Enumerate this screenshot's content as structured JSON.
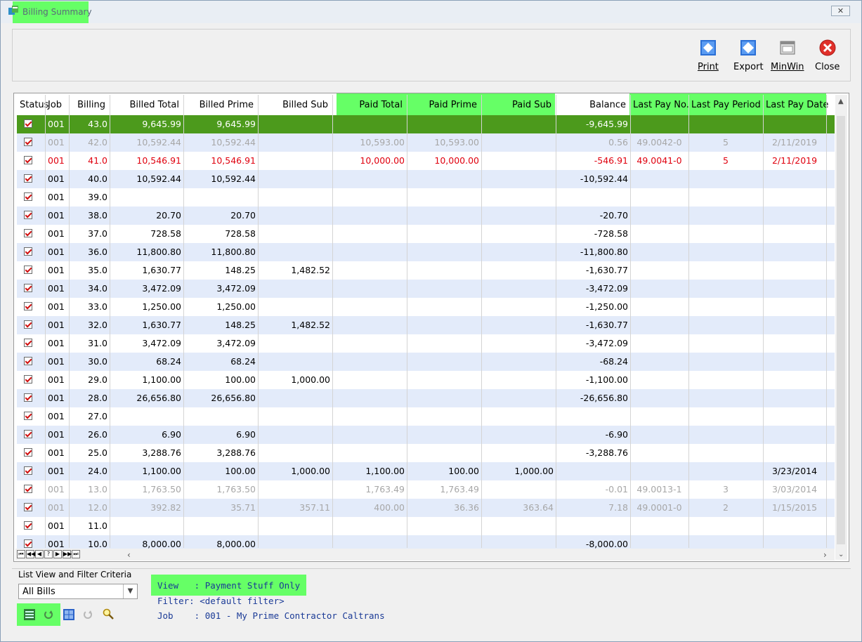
{
  "window": {
    "title": "Billing Summary",
    "close_glyph": "✕"
  },
  "toolbar": {
    "print_label": "Print",
    "export_label": "Export",
    "minwin_label": "MinWin",
    "close_label": "Close"
  },
  "grid": {
    "columns": [
      "Status",
      "Job",
      "Billing",
      "Billed Total",
      "Billed Prime",
      "Billed Sub",
      "Paid Total",
      "Paid Prime",
      "Paid Sub",
      "Balance",
      "Last Pay No.",
      "Last Pay Period",
      "Last Pay Date"
    ],
    "highlighted_columns": [
      "Paid Total",
      "Paid Prime",
      "Paid Sub",
      "Last Pay No.",
      "Last Pay Period",
      "Last Pay Date"
    ],
    "rows": [
      {
        "style": "selected",
        "job": "001",
        "billing": "43.0",
        "billed_total": "9,645.99",
        "billed_prime": "9,645.99",
        "billed_sub": "",
        "paid_total": "",
        "paid_prime": "",
        "paid_sub": "",
        "balance": "-9,645.99",
        "last_pay_no": "",
        "last_pay_period": "",
        "last_pay_date": ""
      },
      {
        "style": "grey",
        "job": "001",
        "billing": "42.0",
        "billed_total": "10,592.44",
        "billed_prime": "10,592.44",
        "billed_sub": "",
        "paid_total": "10,593.00",
        "paid_prime": "10,593.00",
        "paid_sub": "",
        "balance": "0.56",
        "last_pay_no": "49.0042-0",
        "last_pay_period": "5",
        "last_pay_date": "2/11/2019"
      },
      {
        "style": "red",
        "job": "001",
        "billing": "41.0",
        "billed_total": "10,546.91",
        "billed_prime": "10,546.91",
        "billed_sub": "",
        "paid_total": "10,000.00",
        "paid_prime": "10,000.00",
        "paid_sub": "",
        "balance": "-546.91",
        "last_pay_no": "49.0041-0",
        "last_pay_period": "5",
        "last_pay_date": "2/11/2019"
      },
      {
        "style": "normal",
        "job": "001",
        "billing": "40.0",
        "billed_total": "10,592.44",
        "billed_prime": "10,592.44",
        "billed_sub": "",
        "paid_total": "",
        "paid_prime": "",
        "paid_sub": "",
        "balance": "-10,592.44",
        "last_pay_no": "",
        "last_pay_period": "",
        "last_pay_date": ""
      },
      {
        "style": "normal",
        "job": "001",
        "billing": "39.0",
        "billed_total": "",
        "billed_prime": "",
        "billed_sub": "",
        "paid_total": "",
        "paid_prime": "",
        "paid_sub": "",
        "balance": "",
        "last_pay_no": "",
        "last_pay_period": "",
        "last_pay_date": ""
      },
      {
        "style": "normal",
        "job": "001",
        "billing": "38.0",
        "billed_total": "20.70",
        "billed_prime": "20.70",
        "billed_sub": "",
        "paid_total": "",
        "paid_prime": "",
        "paid_sub": "",
        "balance": "-20.70",
        "last_pay_no": "",
        "last_pay_period": "",
        "last_pay_date": ""
      },
      {
        "style": "normal",
        "job": "001",
        "billing": "37.0",
        "billed_total": "728.58",
        "billed_prime": "728.58",
        "billed_sub": "",
        "paid_total": "",
        "paid_prime": "",
        "paid_sub": "",
        "balance": "-728.58",
        "last_pay_no": "",
        "last_pay_period": "",
        "last_pay_date": ""
      },
      {
        "style": "normal",
        "job": "001",
        "billing": "36.0",
        "billed_total": "11,800.80",
        "billed_prime": "11,800.80",
        "billed_sub": "",
        "paid_total": "",
        "paid_prime": "",
        "paid_sub": "",
        "balance": "-11,800.80",
        "last_pay_no": "",
        "last_pay_period": "",
        "last_pay_date": ""
      },
      {
        "style": "normal",
        "job": "001",
        "billing": "35.0",
        "billed_total": "1,630.77",
        "billed_prime": "148.25",
        "billed_sub": "1,482.52",
        "paid_total": "",
        "paid_prime": "",
        "paid_sub": "",
        "balance": "-1,630.77",
        "last_pay_no": "",
        "last_pay_period": "",
        "last_pay_date": ""
      },
      {
        "style": "normal",
        "job": "001",
        "billing": "34.0",
        "billed_total": "3,472.09",
        "billed_prime": "3,472.09",
        "billed_sub": "",
        "paid_total": "",
        "paid_prime": "",
        "paid_sub": "",
        "balance": "-3,472.09",
        "last_pay_no": "",
        "last_pay_period": "",
        "last_pay_date": ""
      },
      {
        "style": "normal",
        "job": "001",
        "billing": "33.0",
        "billed_total": "1,250.00",
        "billed_prime": "1,250.00",
        "billed_sub": "",
        "paid_total": "",
        "paid_prime": "",
        "paid_sub": "",
        "balance": "-1,250.00",
        "last_pay_no": "",
        "last_pay_period": "",
        "last_pay_date": ""
      },
      {
        "style": "normal",
        "job": "001",
        "billing": "32.0",
        "billed_total": "1,630.77",
        "billed_prime": "148.25",
        "billed_sub": "1,482.52",
        "paid_total": "",
        "paid_prime": "",
        "paid_sub": "",
        "balance": "-1,630.77",
        "last_pay_no": "",
        "last_pay_period": "",
        "last_pay_date": ""
      },
      {
        "style": "normal",
        "job": "001",
        "billing": "31.0",
        "billed_total": "3,472.09",
        "billed_prime": "3,472.09",
        "billed_sub": "",
        "paid_total": "",
        "paid_prime": "",
        "paid_sub": "",
        "balance": "-3,472.09",
        "last_pay_no": "",
        "last_pay_period": "",
        "last_pay_date": ""
      },
      {
        "style": "normal",
        "job": "001",
        "billing": "30.0",
        "billed_total": "68.24",
        "billed_prime": "68.24",
        "billed_sub": "",
        "paid_total": "",
        "paid_prime": "",
        "paid_sub": "",
        "balance": "-68.24",
        "last_pay_no": "",
        "last_pay_period": "",
        "last_pay_date": ""
      },
      {
        "style": "normal",
        "job": "001",
        "billing": "29.0",
        "billed_total": "1,100.00",
        "billed_prime": "100.00",
        "billed_sub": "1,000.00",
        "paid_total": "",
        "paid_prime": "",
        "paid_sub": "",
        "balance": "-1,100.00",
        "last_pay_no": "",
        "last_pay_period": "",
        "last_pay_date": ""
      },
      {
        "style": "normal",
        "job": "001",
        "billing": "28.0",
        "billed_total": "26,656.80",
        "billed_prime": "26,656.80",
        "billed_sub": "",
        "paid_total": "",
        "paid_prime": "",
        "paid_sub": "",
        "balance": "-26,656.80",
        "last_pay_no": "",
        "last_pay_period": "",
        "last_pay_date": ""
      },
      {
        "style": "normal",
        "job": "001",
        "billing": "27.0",
        "billed_total": "",
        "billed_prime": "",
        "billed_sub": "",
        "paid_total": "",
        "paid_prime": "",
        "paid_sub": "",
        "balance": "",
        "last_pay_no": "",
        "last_pay_period": "",
        "last_pay_date": ""
      },
      {
        "style": "normal",
        "job": "001",
        "billing": "26.0",
        "billed_total": "6.90",
        "billed_prime": "6.90",
        "billed_sub": "",
        "paid_total": "",
        "paid_prime": "",
        "paid_sub": "",
        "balance": "-6.90",
        "last_pay_no": "",
        "last_pay_period": "",
        "last_pay_date": ""
      },
      {
        "style": "normal",
        "job": "001",
        "billing": "25.0",
        "billed_total": "3,288.76",
        "billed_prime": "3,288.76",
        "billed_sub": "",
        "paid_total": "",
        "paid_prime": "",
        "paid_sub": "",
        "balance": "-3,288.76",
        "last_pay_no": "",
        "last_pay_period": "",
        "last_pay_date": ""
      },
      {
        "style": "normal",
        "job": "001",
        "billing": "24.0",
        "billed_total": "1,100.00",
        "billed_prime": "100.00",
        "billed_sub": "1,000.00",
        "paid_total": "1,100.00",
        "paid_prime": "100.00",
        "paid_sub": "1,000.00",
        "balance": "",
        "last_pay_no": "",
        "last_pay_period": "",
        "last_pay_date": "3/23/2014"
      },
      {
        "style": "grey",
        "job": "001",
        "billing": "13.0",
        "billed_total": "1,763.50",
        "billed_prime": "1,763.50",
        "billed_sub": "",
        "paid_total": "1,763.49",
        "paid_prime": "1,763.49",
        "paid_sub": "",
        "balance": "-0.01",
        "last_pay_no": "49.0013-1",
        "last_pay_period": "3",
        "last_pay_date": "3/03/2014"
      },
      {
        "style": "grey",
        "job": "001",
        "billing": "12.0",
        "billed_total": "392.82",
        "billed_prime": "35.71",
        "billed_sub": "357.11",
        "paid_total": "400.00",
        "paid_prime": "36.36",
        "paid_sub": "363.64",
        "balance": "7.18",
        "last_pay_no": "49.0001-0",
        "last_pay_period": "2",
        "last_pay_date": "1/15/2015"
      },
      {
        "style": "normal",
        "job": "001",
        "billing": "11.0",
        "billed_total": "",
        "billed_prime": "",
        "billed_sub": "",
        "paid_total": "",
        "paid_prime": "",
        "paid_sub": "",
        "balance": "",
        "last_pay_no": "",
        "last_pay_period": "",
        "last_pay_date": ""
      },
      {
        "style": "normal",
        "job": "001",
        "billing": "10.0",
        "billed_total": "8,000.00",
        "billed_prime": "8,000.00",
        "billed_sub": "",
        "paid_total": "",
        "paid_prime": "",
        "paid_sub": "",
        "balance": "-8,000.00",
        "last_pay_no": "",
        "last_pay_period": "",
        "last_pay_date": ""
      }
    ],
    "nav_buttons": [
      "⏮",
      "◀◀",
      "◀",
      "?",
      "▶",
      "▶▶",
      "⏭"
    ]
  },
  "filter": {
    "label": "List View and Filter Criteria",
    "selected": "All Bills",
    "view_line": "View   : Payment Stuff Only",
    "filter_line": "Filter: <default filter>",
    "job_line": "Job    : 001 - My Prime Contractor Caltrans"
  },
  "colors": {
    "highlight": "#66ff66",
    "selected_row": "#4c9a1c",
    "alt_row": "#e3ebfa",
    "red_text": "#e0000e",
    "grey_text": "#a7a7a7",
    "info_text": "#1a3a96"
  }
}
